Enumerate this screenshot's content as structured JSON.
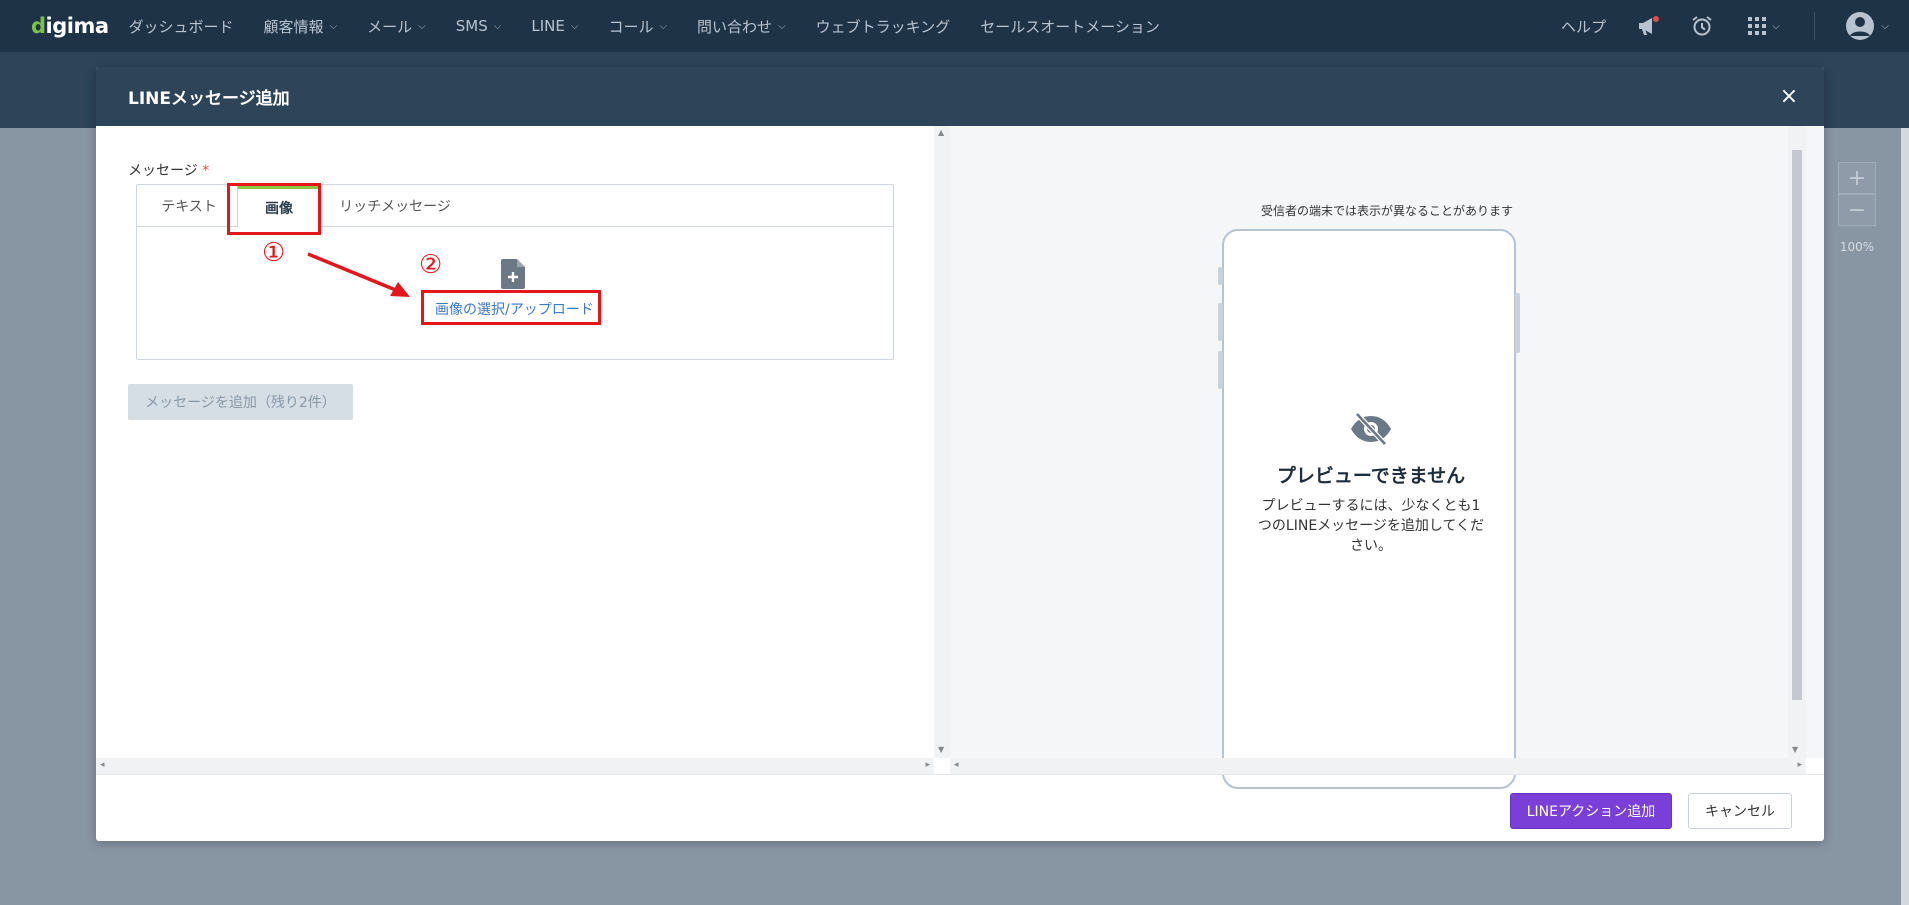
{
  "nav": {
    "logo": "digima",
    "items": [
      {
        "label": "ダッシュボード",
        "dropdown": false
      },
      {
        "label": "顧客情報",
        "dropdown": true
      },
      {
        "label": "メール",
        "dropdown": true
      },
      {
        "label": "SMS",
        "dropdown": true
      },
      {
        "label": "LINE",
        "dropdown": true
      },
      {
        "label": "コール",
        "dropdown": true
      },
      {
        "label": "問い合わせ",
        "dropdown": true
      },
      {
        "label": "ウェブトラッキング",
        "dropdown": false
      },
      {
        "label": "セールスオートメーション",
        "dropdown": false
      }
    ],
    "help": "ヘルプ",
    "icons": [
      "megaphone-icon",
      "alarm-clock-icon",
      "apps-grid-icon",
      "user-avatar-icon"
    ]
  },
  "background": {
    "zoom_in": "+",
    "zoom_out": "−",
    "zoom_level": "100%"
  },
  "modal": {
    "title": "LINEメッセージ追加",
    "close": "×",
    "field_label": "メッセージ",
    "required_mark": "*",
    "tabs": [
      "テキスト",
      "画像",
      "リッチメッセージ"
    ],
    "active_tab": "画像",
    "upload_link": "画像の選択/アップロード",
    "add_message_button": "メッセージを追加（残り2件）",
    "preview_notice": "受信者の端末では表示が異なることがあります",
    "no_preview_title": "プレビューできません",
    "no_preview_text": "プレビューするには、少なくとも1つのLINEメッセージを追加してください。",
    "primary_button": "LINEアクション追加",
    "cancel_button": "キャンセル"
  },
  "annotations": {
    "step1": "①",
    "step2": "②"
  },
  "colors": {
    "nav_bg": "#1f3347",
    "modal_header_bg": "#2d4459",
    "primary": "#7a3fd6",
    "tab_accent": "#8cc63f",
    "link": "#3a78c8",
    "annotation_red": "#e4161c"
  }
}
